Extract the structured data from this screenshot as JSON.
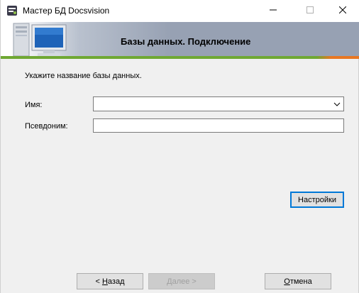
{
  "window": {
    "title": "Мастер БД Docsvision"
  },
  "banner": {
    "title": "Базы данных. Подключение"
  },
  "form": {
    "prompt": "Укажите название базы данных.",
    "name_label": "Имя:",
    "name_value": "",
    "alias_label": "Псевдоним:",
    "alias_value": ""
  },
  "buttons": {
    "settings": "Настройки",
    "back_prefix": "< ",
    "back_accel": "Н",
    "back_rest": "азад",
    "next_accel": "Д",
    "next_rest": "алее >",
    "cancel_accel": "О",
    "cancel_rest": "тмена"
  },
  "colors": {
    "banner_green": "#6fa833",
    "banner_orange": "#e87722",
    "focus_blue": "#0078d7"
  }
}
